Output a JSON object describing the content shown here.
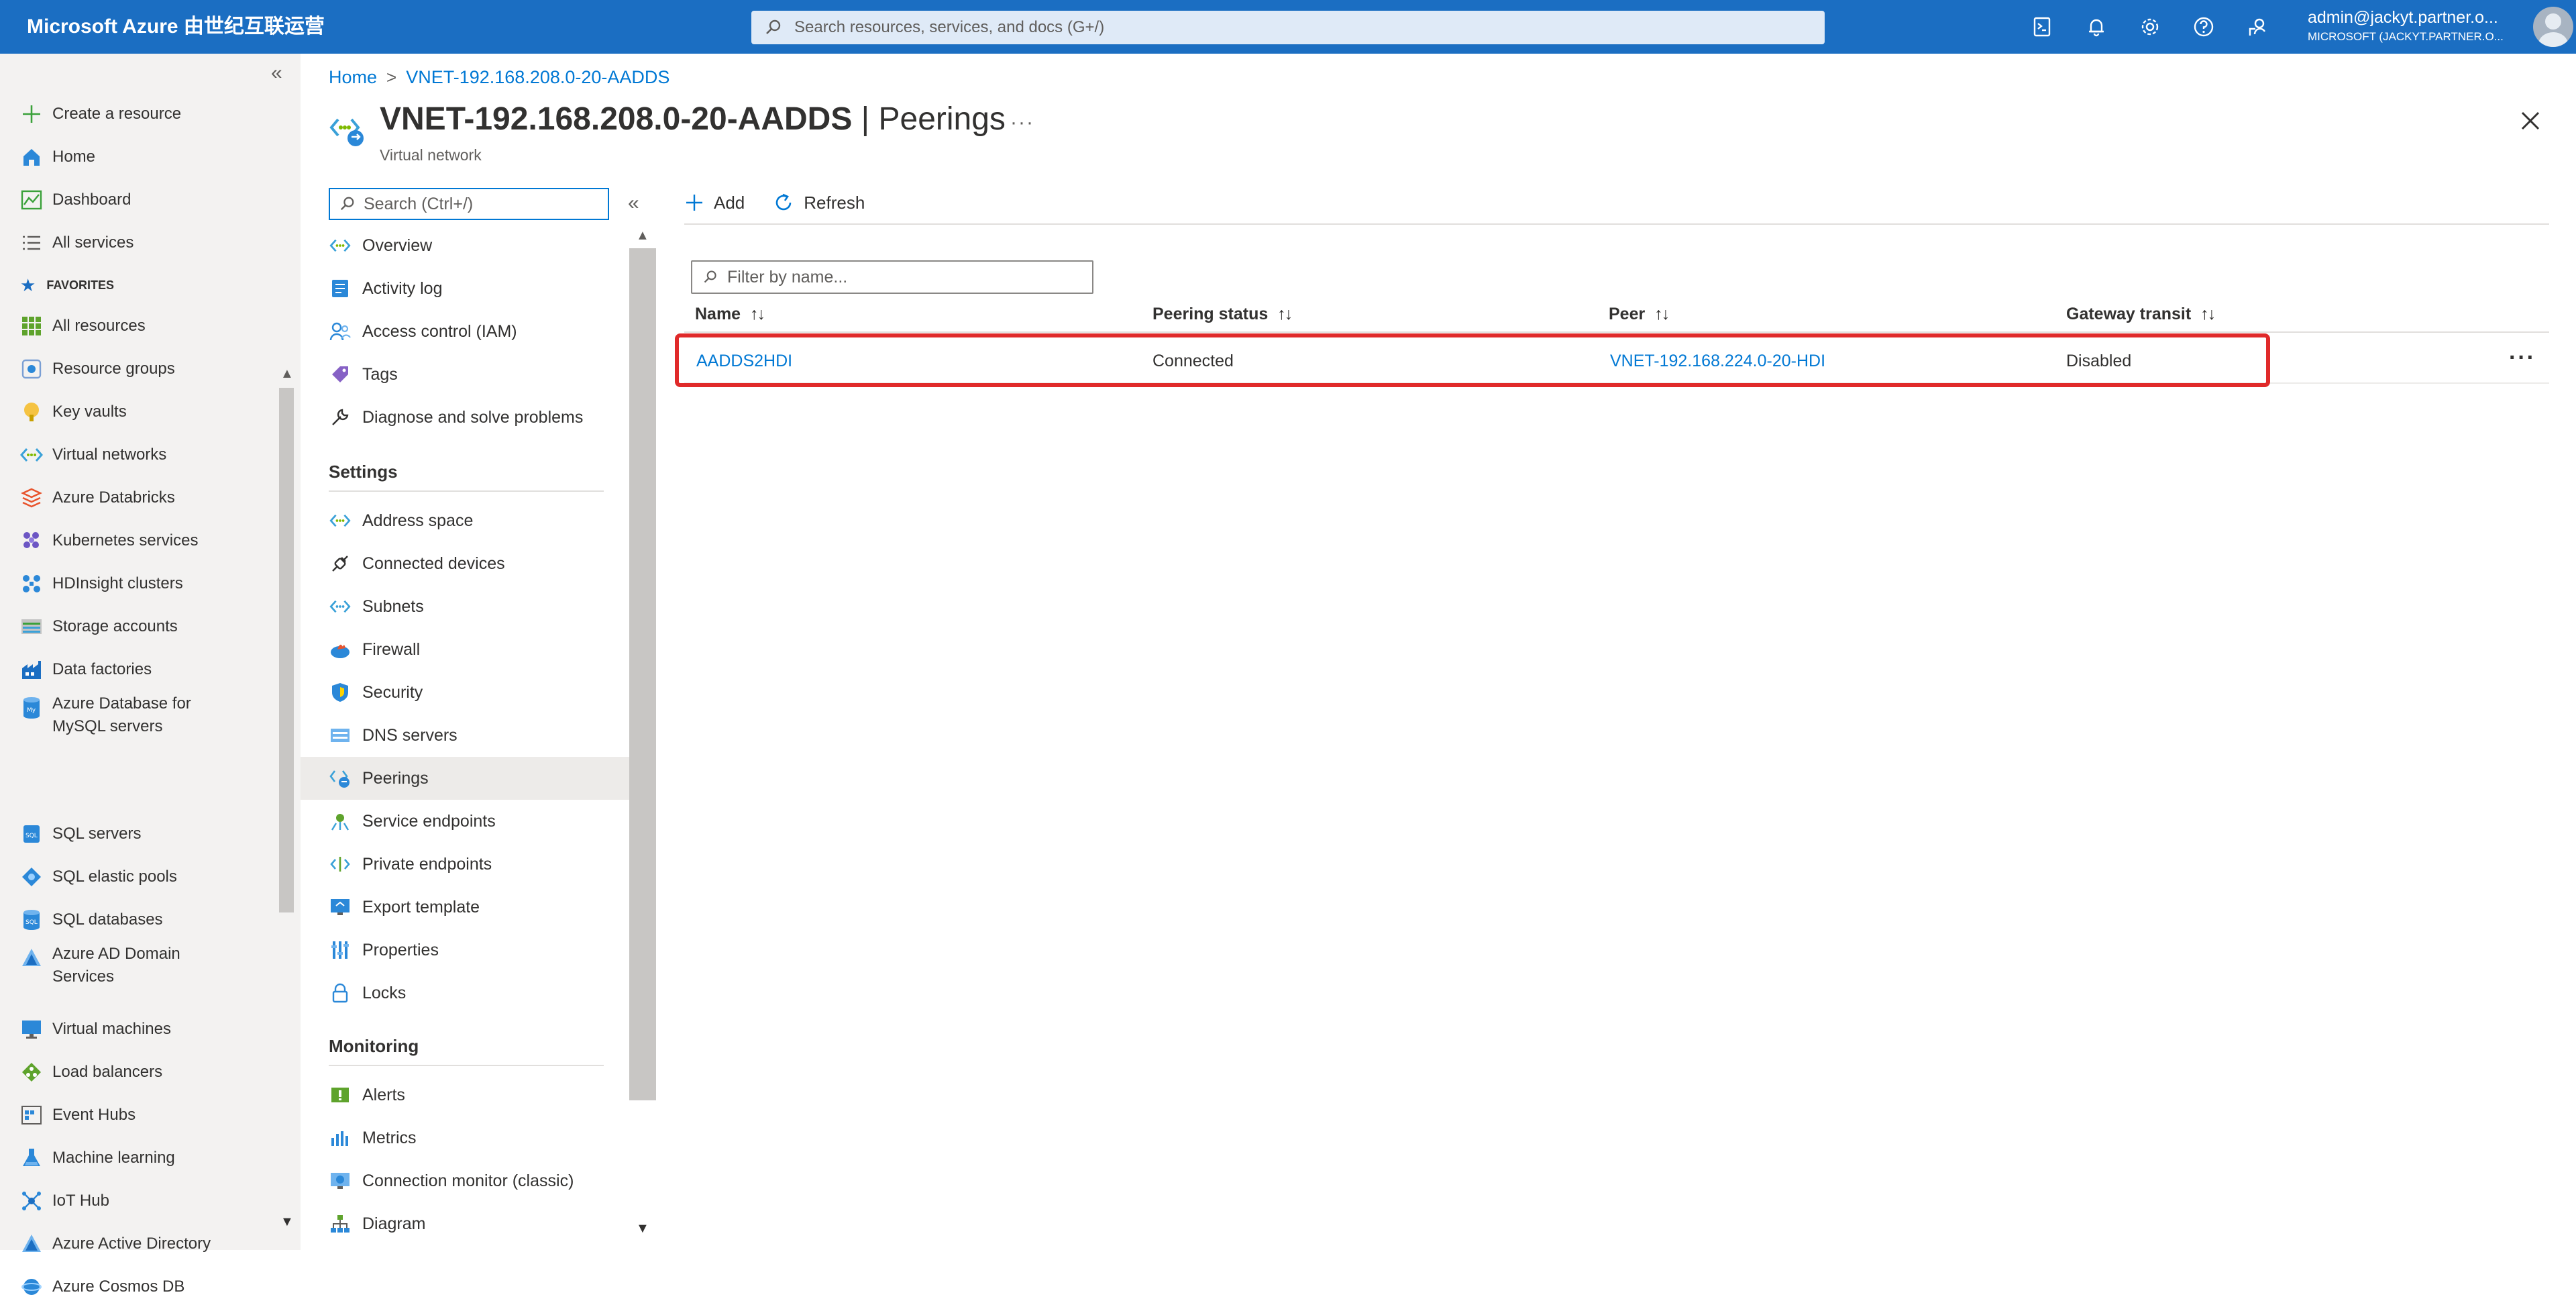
{
  "topbar": {
    "brand": "Microsoft Azure 由世纪互联运营",
    "search_placeholder": "Search resources, services, and docs (G+/)",
    "account_name": "admin@jackyt.partner.o...",
    "account_tenant": "MICROSOFT (JACKYT.PARTNER.O...",
    "icons": [
      "cloud-shell-icon",
      "notifications-icon",
      "settings-icon",
      "help-icon",
      "feedback-icon"
    ]
  },
  "leftnav": {
    "create": "Create a resource",
    "home": "Home",
    "dashboard": "Dashboard",
    "all_services": "All services",
    "favorites_label": "FAVORITES",
    "favorites": [
      "All resources",
      "Resource groups",
      "Key vaults",
      "Virtual networks",
      "Azure Databricks",
      "Kubernetes services",
      "HDInsight clusters",
      "Storage accounts",
      "Data factories",
      "Azure Database for MySQL servers",
      "SQL servers",
      "SQL elastic pools",
      "SQL databases",
      "Azure AD Domain Services",
      "Virtual machines",
      "Load balancers",
      "Event Hubs",
      "Machine learning",
      "IoT Hub",
      "Azure Active Directory",
      "Azure Cosmos DB"
    ]
  },
  "breadcrumb": {
    "home": "Home",
    "resource": "VNET-192.168.208.0-20-AADDS"
  },
  "header": {
    "resource_name": "VNET-192.168.208.0-20-AADDS",
    "page_name": " | Peerings",
    "subtitle": "Virtual network",
    "more": "···"
  },
  "resmenu": {
    "search_placeholder": "Search (Ctrl+/)",
    "top_items": [
      "Overview",
      "Activity log",
      "Access control (IAM)",
      "Tags",
      "Diagnose and solve problems"
    ],
    "settings_label": "Settings",
    "settings_items": [
      "Address space",
      "Connected devices",
      "Subnets",
      "Firewall",
      "Security",
      "DNS servers",
      "Peerings",
      "Service endpoints",
      "Private endpoints",
      "Export template",
      "Properties",
      "Locks"
    ],
    "monitoring_label": "Monitoring",
    "monitoring_items": [
      "Alerts",
      "Metrics",
      "Connection monitor (classic)",
      "Diagram"
    ],
    "selected": "Peerings"
  },
  "toolbar": {
    "add": "Add",
    "refresh": "Refresh"
  },
  "filter": {
    "placeholder": "Filter by name..."
  },
  "table": {
    "columns": [
      "Name",
      "Peering status",
      "Peer",
      "Gateway transit"
    ],
    "sort_glyph": "↑↓",
    "rows": [
      {
        "name": "AADDS2HDI",
        "status": "Connected",
        "peer": "VNET-192.168.224.0-20-HDI",
        "gateway_transit": "Disabled"
      }
    ]
  },
  "colors": {
    "topbar": "#1b6ec2",
    "accent": "#0078d4",
    "highlight": "#e02a2a"
  }
}
